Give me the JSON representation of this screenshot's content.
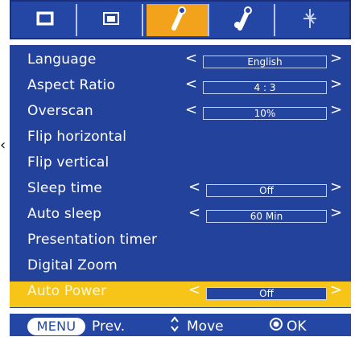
{
  "tabs": [
    {
      "icon": "picture-icon",
      "active": false
    },
    {
      "icon": "screen-icon",
      "active": false
    },
    {
      "icon": "wrench-icon",
      "active": true
    },
    {
      "icon": "wrench-gear-icon",
      "active": false
    },
    {
      "icon": "network-icon",
      "active": false
    }
  ],
  "menu": [
    {
      "label": "Language",
      "value": "English"
    },
    {
      "label": "Aspect Ratio",
      "value": "4 : 3"
    },
    {
      "label": "Overscan",
      "value": "10%"
    },
    {
      "label": "Flip horizontal",
      "value": ""
    },
    {
      "label": "Flip vertical",
      "value": ""
    },
    {
      "label": "Sleep time",
      "value": "Off"
    },
    {
      "label": "Auto sleep",
      "value": "60 Min"
    },
    {
      "label": "Presentation timer",
      "value": ""
    },
    {
      "label": "Digital Zoom",
      "value": ""
    },
    {
      "label": "Auto Power",
      "value": "Off",
      "selected": true
    }
  ],
  "footer": {
    "menu_label": "MENU",
    "prev_label": "Prev.",
    "move_label": "Move",
    "ok_label": "OK"
  },
  "colors": {
    "panel": "#23429B",
    "highlight": "#F7C418",
    "active_tab": "#F2A21B"
  }
}
